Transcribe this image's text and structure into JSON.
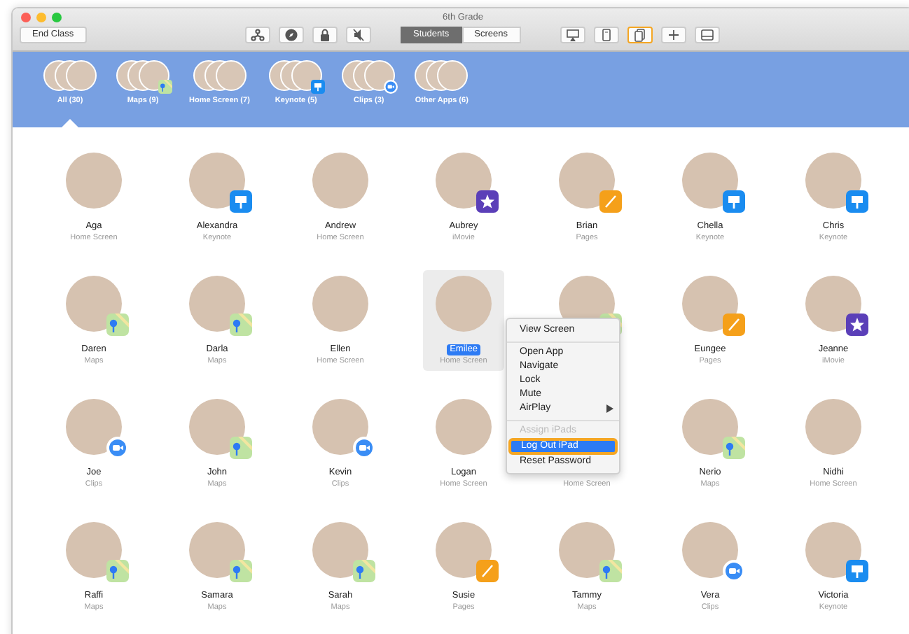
{
  "window": {
    "title": "6th Grade"
  },
  "toolbar": {
    "end_button": "End Class",
    "left_tools": [
      {
        "kind": "share"
      },
      {
        "kind": "navigate"
      },
      {
        "kind": "lock"
      },
      {
        "kind": "mute"
      }
    ],
    "view_tabs": [
      {
        "label": "Students",
        "selected": true
      },
      {
        "label": "Screens",
        "selected": false
      }
    ],
    "right_tools": [
      {
        "kind": "airplay",
        "selected": false
      },
      {
        "kind": "ipad",
        "selected": false
      },
      {
        "kind": "groups",
        "selected": true
      },
      {
        "kind": "add",
        "selected": false
      },
      {
        "kind": "tray",
        "selected": false
      }
    ]
  },
  "groups": [
    {
      "label": "All (30)",
      "kind": "plain",
      "selected": true
    },
    {
      "label": "Maps (9)",
      "kind": "maps",
      "selected": false
    },
    {
      "label": "Home Screen (7)",
      "kind": "plain",
      "selected": false
    },
    {
      "label": "Keynote (5)",
      "kind": "keynote",
      "selected": false
    },
    {
      "label": "Clips (3)",
      "kind": "clips",
      "selected": false
    },
    {
      "label": "Other Apps (6)",
      "kind": "plain",
      "selected": false
    }
  ],
  "students": [
    {
      "name": "Aga",
      "app": "Home Screen",
      "kind": "plain",
      "selected": false
    },
    {
      "name": "Alexandra",
      "app": "Keynote",
      "kind": "keynote",
      "selected": false
    },
    {
      "name": "Andrew",
      "app": "Home Screen",
      "kind": "plain",
      "selected": false
    },
    {
      "name": "Aubrey",
      "app": "iMovie",
      "kind": "imovie",
      "selected": false
    },
    {
      "name": "Brian",
      "app": "Pages",
      "kind": "pages",
      "selected": false
    },
    {
      "name": "Chella",
      "app": "Keynote",
      "kind": "keynote",
      "selected": false
    },
    {
      "name": "Chris",
      "app": "Keynote",
      "kind": "keynote",
      "selected": false
    },
    {
      "name": "Daren",
      "app": "Maps",
      "kind": "maps",
      "selected": false
    },
    {
      "name": "Darla",
      "app": "Maps",
      "kind": "maps",
      "selected": false
    },
    {
      "name": "Ellen",
      "app": "Home Screen",
      "kind": "plain",
      "selected": false
    },
    {
      "name": "Emilee",
      "app": "Home Screen",
      "kind": "plain",
      "selected": true
    },
    {
      "kind": "maps",
      "selected": false
    },
    {
      "name": "Eungee",
      "app": "Pages",
      "kind": "pages",
      "selected": false
    },
    {
      "name": "Jeanne",
      "app": "iMovie",
      "kind": "imovie",
      "selected": false
    },
    {
      "name": "Joe",
      "app": "Clips",
      "kind": "clips",
      "selected": false
    },
    {
      "name": "John",
      "app": "Maps",
      "kind": "maps",
      "selected": false
    },
    {
      "name": "Kevin",
      "app": "Clips",
      "kind": "clips",
      "selected": false
    },
    {
      "name": "Logan",
      "app": "Home Screen",
      "kind": "plain",
      "selected": false
    },
    {
      "app": "Home Screen",
      "kind": "plain",
      "selected": false
    },
    {
      "name": "Nerio",
      "app": "Maps",
      "kind": "maps",
      "selected": false
    },
    {
      "name": "Nidhi",
      "app": "Home Screen",
      "kind": "plain",
      "selected": false
    },
    {
      "name": "Raffi",
      "app": "Maps",
      "kind": "maps",
      "selected": false
    },
    {
      "name": "Samara",
      "app": "Maps",
      "kind": "maps",
      "selected": false
    },
    {
      "name": "Sarah",
      "app": "Maps",
      "kind": "maps",
      "selected": false
    },
    {
      "name": "Susie",
      "app": "Pages",
      "kind": "pages",
      "selected": false
    },
    {
      "name": "Tammy",
      "app": "Maps",
      "kind": "maps",
      "selected": false
    },
    {
      "name": "Vera",
      "app": "Clips",
      "kind": "clips",
      "selected": false
    },
    {
      "name": "Victoria",
      "app": "Keynote",
      "kind": "keynote",
      "selected": false
    }
  ],
  "context_menu": {
    "items": [
      {
        "kind": "item",
        "label": "View Screen",
        "disabled": false,
        "selected": false,
        "submenu": false
      },
      {
        "kind": "separator"
      },
      {
        "kind": "item",
        "label": "Open App",
        "disabled": false,
        "selected": false,
        "submenu": false
      },
      {
        "kind": "item",
        "label": "Navigate",
        "disabled": false,
        "selected": false,
        "submenu": false
      },
      {
        "kind": "item",
        "label": "Lock",
        "disabled": false,
        "selected": false,
        "submenu": false
      },
      {
        "kind": "item",
        "label": "Mute",
        "disabled": false,
        "selected": false,
        "submenu": false
      },
      {
        "kind": "item",
        "label": "AirPlay",
        "disabled": false,
        "selected": false,
        "submenu": true
      },
      {
        "kind": "separator"
      },
      {
        "kind": "item",
        "label": "Assign iPads",
        "disabled": true,
        "selected": false,
        "submenu": false
      },
      {
        "kind": "item",
        "label": "Log Out iPad",
        "disabled": false,
        "selected": true,
        "submenu": false
      },
      {
        "kind": "item",
        "label": "Reset Password",
        "disabled": false,
        "selected": false,
        "submenu": false
      }
    ]
  }
}
